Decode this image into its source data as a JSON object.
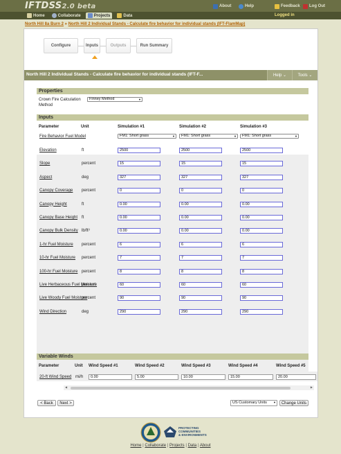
{
  "app": {
    "logo": "IFTDSS",
    "version": "2.0 beta"
  },
  "top_links": {
    "about": "About",
    "help": "Help",
    "feedback": "Feedback",
    "logout": "Log Out"
  },
  "tabs": [
    "Home",
    "Collaborate",
    "Projects",
    "Data"
  ],
  "logged_in": "Logged in",
  "breadcrumb": {
    "root": "North Hill 8a Burn 2",
    "sep": " » ",
    "current": "North Hill 2 Individual Stands - Calculate fire behavior for individual stands (IFT-FlamMap)"
  },
  "stepper": {
    "configure": "Configure",
    "inputs": "Inputs",
    "outputs": "Outputs",
    "run_summary": "Run Summary"
  },
  "panel": {
    "title": "North Hill 2 Individual Stands - Calculate fire behavior for individual stands (IFT-F...",
    "help": "Help",
    "tools": "Tools"
  },
  "properties": {
    "heading": "Properties",
    "crown_label": "Crown Fire Calculation Method",
    "crown_value": "Finney Method"
  },
  "inputs": {
    "heading": "Inputs",
    "columns": {
      "parameter": "Parameter",
      "unit": "Unit",
      "sim1": "Simulation #1",
      "sim2": "Simulation #2",
      "sim3": "Simulation #3"
    },
    "fuel_model": {
      "label": "Fire Behavior Fuel Model",
      "value": "FM1: Short grass"
    },
    "rows": [
      {
        "label": "Elevation",
        "unit": "ft",
        "values": [
          "2500",
          "2500",
          "2500"
        ]
      },
      {
        "label": "Slope",
        "unit": "percent",
        "values": [
          "15",
          "15",
          "15"
        ]
      },
      {
        "label": "Aspect",
        "unit": "deg",
        "values": [
          "327",
          "327",
          "327"
        ]
      },
      {
        "label": "Canopy Coverage",
        "unit": "percent",
        "values": [
          "0",
          "0",
          "0"
        ]
      },
      {
        "label": "Canopy Height",
        "unit": "ft",
        "values": [
          "0.00",
          "0.00",
          "0.00"
        ]
      },
      {
        "label": "Canopy Base Height",
        "unit": "ft",
        "values": [
          "0.00",
          "0.00",
          "0.00"
        ]
      },
      {
        "label": "Canopy Bulk Density",
        "unit": "lb/ft³",
        "values": [
          "0.00",
          "0.00",
          "0.00"
        ]
      },
      {
        "label": "1-hr Fuel Moisture",
        "unit": "percent",
        "values": [
          "6",
          "6",
          "6"
        ]
      },
      {
        "label": "10-hr Fuel Moisture",
        "unit": "percent",
        "values": [
          "7",
          "7",
          "7"
        ]
      },
      {
        "label": "100-hr Fuel Moisture",
        "unit": "percent",
        "values": [
          "8",
          "8",
          "8"
        ]
      },
      {
        "label": "Live Herbaceous Fuel Moisture",
        "unit": "percent",
        "values": [
          "60",
          "60",
          "60"
        ]
      },
      {
        "label": "Live Woody Fuel Moisture",
        "unit": "percent",
        "values": [
          "90",
          "90",
          "90"
        ]
      },
      {
        "label": "Wind Direction",
        "unit": "deg",
        "values": [
          "290",
          "290",
          "290"
        ]
      }
    ]
  },
  "variable_winds": {
    "heading": "Variable Winds",
    "columns": {
      "parameter": "Parameter",
      "unit": "Unit",
      "ws1": "Wind Speed #1",
      "ws2": "Wind Speed #2",
      "ws3": "Wind Speed #3",
      "ws4": "Wind Speed #4",
      "ws5": "Wind Speed #5"
    },
    "row": {
      "label": "20-ft Wind Speed",
      "unit": "mi/h",
      "values": [
        "0.00",
        "5.00",
        "10.00",
        "15.00",
        "20.00"
      ]
    }
  },
  "buttons": {
    "back": "< Back",
    "next": "Next >",
    "units_value": "US Customary Units",
    "change_units": "Change Units"
  },
  "logos": {
    "pce_line1": "PROTECTING",
    "pce_line2": "COMMUNITIES",
    "pce_line3": "& ENVIRONMENTS"
  },
  "footer": {
    "home": "Home",
    "collaborate": "Collaborate",
    "projects": "Projects",
    "data": "Data",
    "about": "About",
    "sep": "|"
  },
  "colors": {
    "banner": "#6b6f45",
    "navbar": "#4d5230",
    "section": "#c5c89e",
    "titlebar": "#8e9168",
    "link": "#b06000",
    "input_border": "#6868d8"
  }
}
